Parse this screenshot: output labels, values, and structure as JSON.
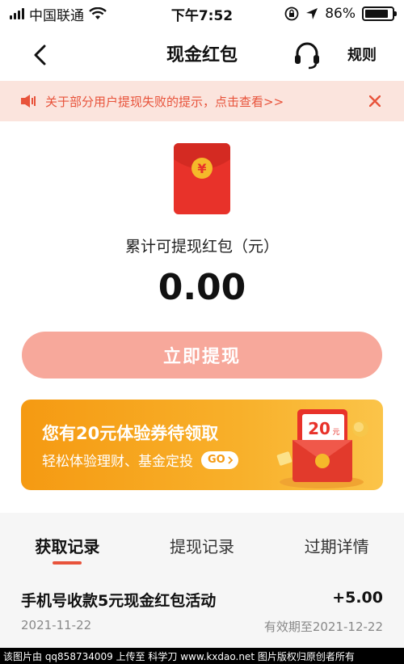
{
  "status_bar": {
    "carrier": "中国联通",
    "time": "下午7:52",
    "battery_percent": "86%",
    "battery_level": 0.86
  },
  "nav": {
    "title": "现金红包",
    "rules_label": "规则"
  },
  "notice": {
    "text": "关于部分用户提现失败的提示，点击查看>>"
  },
  "main": {
    "label": "累计可提现红包（元）",
    "amount": "0.00",
    "withdraw_button": "立即提现",
    "envelope_symbol": "¥"
  },
  "banner": {
    "title": "您有20元体验券待领取",
    "subtitle": "轻松体验理财、基金定投",
    "go_label": "GO",
    "coupon_amount": "20",
    "coupon_unit": "元"
  },
  "tabs": [
    {
      "label": "获取记录",
      "active": true
    },
    {
      "label": "提现记录",
      "active": false
    },
    {
      "label": "过期详情",
      "active": false
    }
  ],
  "records": [
    {
      "title": "手机号收款5元现金红包活动",
      "amount": "+5.00",
      "date": "2021-11-22",
      "expiry": "有效期至2021-12-22"
    }
  ],
  "watermark": {
    "text": "该图片由 qq858734009 上传至 科学刀 www.kxdao.net 图片版权归原创者所有"
  },
  "colors": {
    "accent": "#e8533b",
    "notice_bg": "#fbe4dd",
    "button_disabled": "#f7a89b",
    "banner_orange": "#f59a12",
    "envelope_red": "#e8322a",
    "coin_gold": "#f5b92a"
  }
}
